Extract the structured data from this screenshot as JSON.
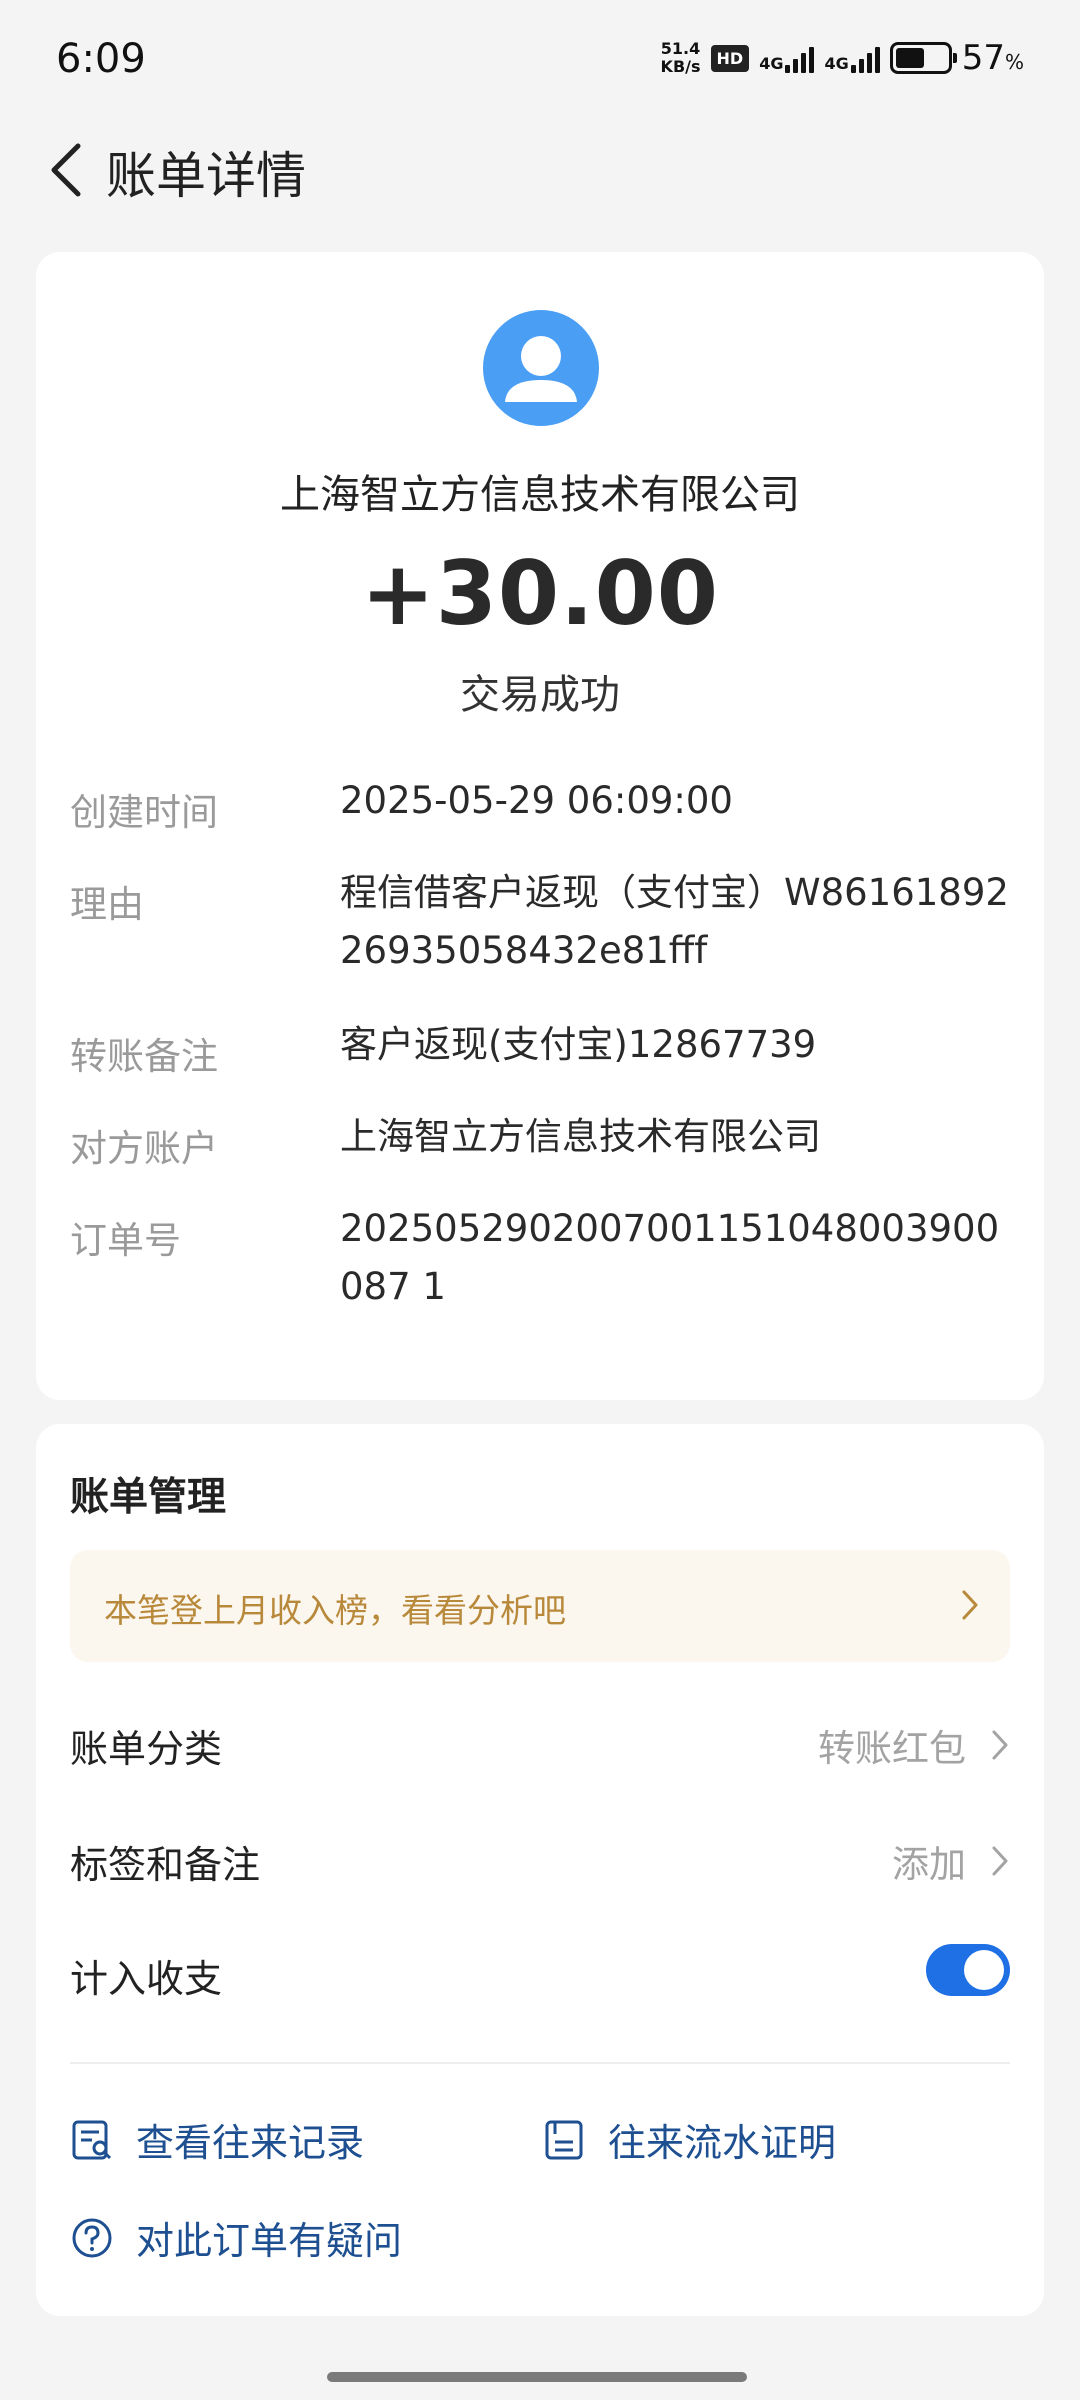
{
  "status_bar": {
    "time": "6:09",
    "speed_value": "51.4",
    "speed_unit": "KB/s",
    "hd": "HD",
    "network_1": "4G",
    "network_2": "4G",
    "battery_percent": "57",
    "battery_unit": "%"
  },
  "header": {
    "title": "账单详情"
  },
  "transaction": {
    "merchant": "上海智立方信息技术有限公司",
    "amount": "+30.00",
    "status": "交易成功",
    "details": [
      {
        "label": "创建时间",
        "value": "2025-05-29 06:09:00"
      },
      {
        "label": "理由",
        "value": "程信借客户返现（支付宝）W8616189226935058432e81fff"
      },
      {
        "label": "转账备注",
        "value": "客户返现(支付宝)12867739"
      },
      {
        "label": "对方账户",
        "value": "上海智立方信息技术有限公司"
      },
      {
        "label": "订单号",
        "value": "2025052902007001151048003900087 1"
      }
    ]
  },
  "management": {
    "title": "账单管理",
    "banner": "本笔登上月收入榜，看看分析吧",
    "category_label": "账单分类",
    "category_value": "转账红包",
    "tags_label": "标签和备注",
    "tags_value": "添加",
    "include_label": "计入收支",
    "include_enabled": true,
    "links": {
      "records": "查看往来记录",
      "proof": "往来流水证明",
      "question": "对此订单有疑问"
    }
  },
  "colors": {
    "accent": "#1f6fe5",
    "link": "#1d4f91",
    "banner_text": "#b8893a",
    "avatar": "#4a9ff5"
  },
  "icons": {
    "back": "back-arrow-icon",
    "avatar": "person-icon",
    "records": "record-list-icon",
    "proof": "document-proof-icon",
    "question": "question-circle-icon",
    "chevron": "chevron-right-icon"
  }
}
